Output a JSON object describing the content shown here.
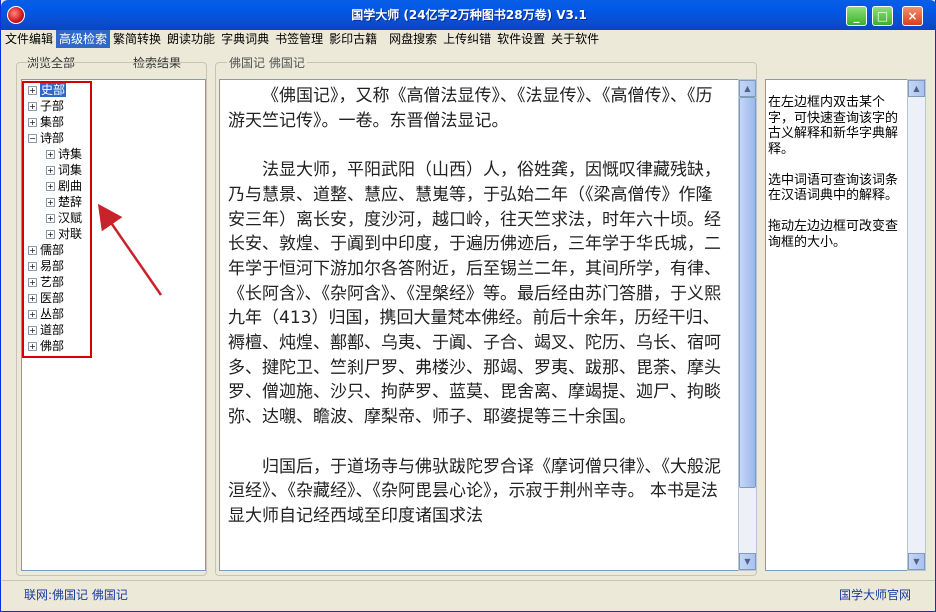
{
  "window": {
    "title": "国学大师 (24亿字2万种图书28万卷) V3.1"
  },
  "menu": [
    "文件编辑",
    "高级检索",
    "繁简转换",
    "朗读功能",
    "字典词典",
    "书签管理",
    "影印古籍",
    "网盘搜索",
    "上传纠错",
    "软件设置",
    "关于软件"
  ],
  "active_menu": "高级检索",
  "left_tabs": {
    "browse": "浏览全部",
    "search": "检索结果"
  },
  "tree": {
    "root": [
      {
        "label": "史部",
        "sign": "+",
        "selected": true
      },
      {
        "label": "子部",
        "sign": "+"
      },
      {
        "label": "集部",
        "sign": "+"
      },
      {
        "label": "诗部",
        "sign": "−"
      }
    ],
    "children": [
      {
        "label": "诗集",
        "sign": "+"
      },
      {
        "label": "词集",
        "sign": "+"
      },
      {
        "label": "剧曲",
        "sign": "+"
      },
      {
        "label": "楚辞",
        "sign": "+"
      },
      {
        "label": "汉赋",
        "sign": "+"
      },
      {
        "label": "对联",
        "sign": "+"
      }
    ],
    "root_after": [
      {
        "label": "儒部",
        "sign": "+"
      },
      {
        "label": "易部",
        "sign": "+"
      },
      {
        "label": "艺部",
        "sign": "+"
      },
      {
        "label": "医部",
        "sign": "+"
      },
      {
        "label": "丛部",
        "sign": "+"
      },
      {
        "label": "道部",
        "sign": "+"
      },
      {
        "label": "佛部",
        "sign": "+"
      }
    ]
  },
  "content": {
    "breadcrumb": "佛国记  佛国记",
    "paragraphs": [
      "《佛国记》，又称《高僧法显传》、《法显传》、《高僧传》、《历游天竺记传》。一卷。东晋僧法显记。",
      "法显大师，平阳武阳（山西）人，俗姓龚，因慨叹律藏残缺，乃与慧景、道整、慧应、慧嵬等，于弘始二年（《梁高僧传》作隆安三年）离长安，度沙河，越口岭，往天竺求法，时年六十顷。经长安、敦煌、于阗到中印度，于遍历佛迹后，三年学于华氏城，二年学于恒河下游加尔各答附近，后至锡兰二年，其间所学，有律、《长阿含》、《杂阿含》、《涅槃经》等。最后经由苏门答腊，于义熙九年（413）归国，携回大量梵本佛经。前后十余年，历经干归、褥檀、炖煌、鄯鄯、乌夷、于阗、子合、竭叉、陀历、乌长、宿呵多、揵陀卫、竺刹尸罗、弗楼沙、那竭、罗夷、跋那、毘荼、摩头罗、僧迦施、沙只、拘萨罗、蓝莫、毘舍离、摩竭提、迦尸、拘睒弥、达嚫、瞻波、摩梨帝、师子、耶婆提等三十余国。",
      "归国后，于道场寺与佛驮跋陀罗合译《摩诃僧只律》、《大般泥洹经》、《杂藏经》、《杂阿毘昙心论》，示寂于荆州辛寺。  本书是法显大师自记经西域至印度诸国求法"
    ]
  },
  "help": [
    "在左边框内双击某个字，可快速查询该字的古义解释和新华字典解释。",
    "选中词语可查询该词条在汉语词典中的解释。",
    "拖动左边边框可改变查询框的大小。"
  ],
  "status": {
    "left": "联网:佛国记   佛国记",
    "right": "国学大师官网"
  }
}
